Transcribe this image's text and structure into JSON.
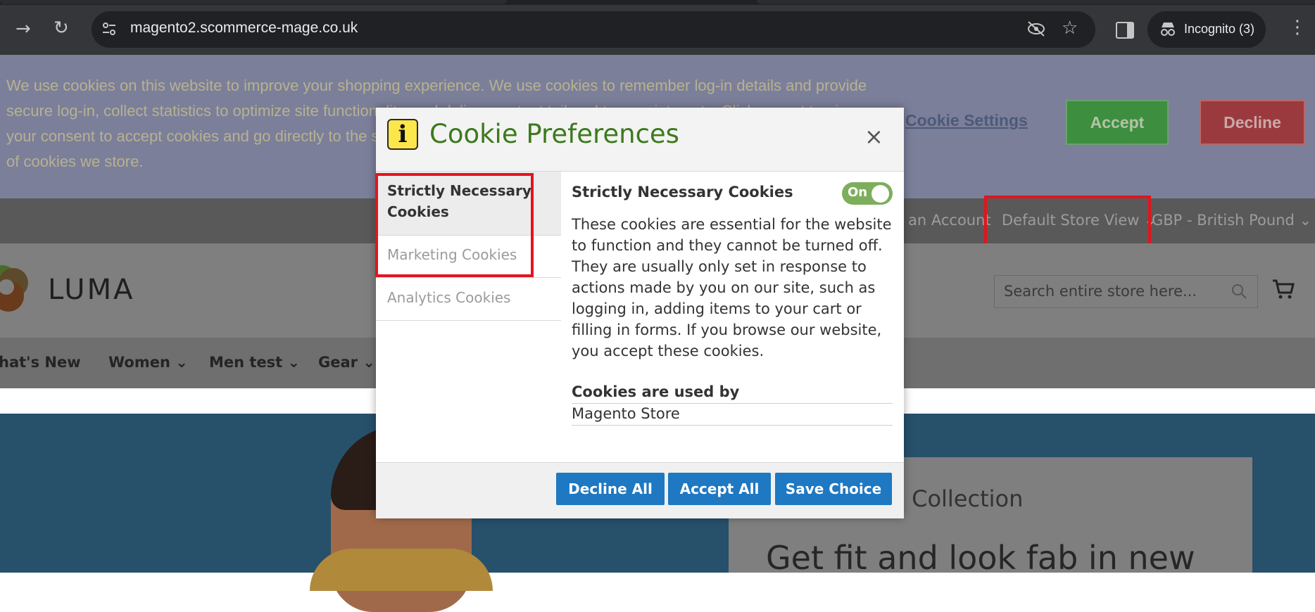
{
  "browser": {
    "url": "magento2.scommerce-mage.co.uk",
    "incognito_label": "Incognito (3)"
  },
  "cookie_bar": {
    "text": "We use cookies on this website to improve your shopping experience. We use cookies to remember log-in details and provide secure log-in, collect statistics to optimize site functionality, and deliver content tailored to your interests. Click accept to give your consent to accept cookies and go directly to the site or click on more information to see detailed descriptions of the types of cookies we store.",
    "settings_link": "Cookie Settings",
    "accept": "Accept",
    "decline": "Decline"
  },
  "topbar": {
    "account": "an Account",
    "store_view": "Default Store View",
    "currency": "GBP - British Pound"
  },
  "header": {
    "logo": "LUMA",
    "search_placeholder": "Search entire store here..."
  },
  "nav": [
    "hat's New",
    "Women",
    "Men test",
    "Gear"
  ],
  "hero": {
    "subtitle": "ga Collection",
    "title": "Get fit and look fab in new"
  },
  "modal": {
    "title": "Cookie Preferences",
    "close": "×",
    "tabs": [
      "Strictly Necessary Cookies",
      "Marketing Cookies",
      "Analytics Cookies"
    ],
    "section_title": "Strictly Necessary Cookies",
    "toggle_label": "On",
    "toggle_state": "on",
    "description": "These cookies are essential for the website to function and they cannot be turned off. They are usually only set in response to actions made by you on our site, such as logging in, adding items to your cart or filling in forms. If you browse our website, you accept these cookies.",
    "used_by_label": "Cookies are used by",
    "used_by_value": "Magento Store",
    "buttons": {
      "decline_all": "Decline All",
      "accept_all": "Accept All",
      "save_choice": "Save Choice"
    }
  },
  "colors": {
    "primary_button": "#1e78c2",
    "title_green": "#3d7a1c",
    "toggle_on": "#7cae5c",
    "highlight_red": "#e3141f"
  }
}
